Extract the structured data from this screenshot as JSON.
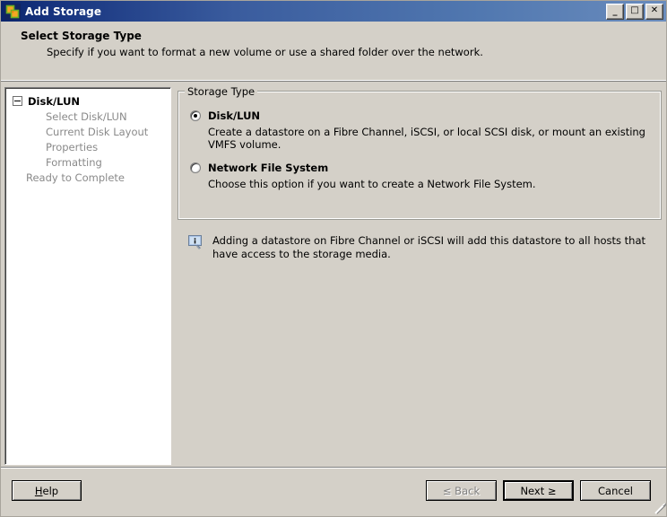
{
  "window": {
    "title": "Add Storage",
    "icon": "vmware-storage-icon",
    "controls": {
      "minimize": "_",
      "maximize": "□",
      "close": "✕"
    }
  },
  "header": {
    "title": "Select Storage Type",
    "subtitle": "Specify if you want to format a new volume or use a shared folder over the network."
  },
  "wizard_steps": {
    "root": {
      "label": "Disk/LUN",
      "expanded": true
    },
    "children": [
      {
        "label": "Select Disk/LUN"
      },
      {
        "label": "Current Disk Layout"
      },
      {
        "label": "Properties"
      },
      {
        "label": "Formatting"
      }
    ],
    "final": {
      "label": "Ready to Complete"
    }
  },
  "storage_type": {
    "legend": "Storage Type",
    "options": [
      {
        "label": "Disk/LUN",
        "description": "Create a datastore on a Fibre Channel, iSCSI, or local SCSI disk, or mount an existing VMFS volume.",
        "selected": true
      },
      {
        "label": "Network File System",
        "description": "Choose this option if you want to create a Network File System.",
        "selected": false
      }
    ]
  },
  "note": {
    "icon": "info-tooltip-icon",
    "text": "Adding a datastore on Fibre Channel or iSCSI will add this datastore to all hosts that have access to the storage media."
  },
  "footer": {
    "help_label": "Help",
    "help_accelerator": "H",
    "back_label": "≤ Back",
    "next_label": "Next ≥",
    "cancel_label": "Cancel",
    "back_disabled": true,
    "next_default": true
  },
  "colors": {
    "dialog_face": "#d4d0c8",
    "titlebar_dark": "#0a246a",
    "titlebar_light": "#6a8cbd",
    "panel_white": "#ffffff",
    "disabled_text": "#8a8a8a",
    "info_icon_blue": "#aec6e8"
  }
}
